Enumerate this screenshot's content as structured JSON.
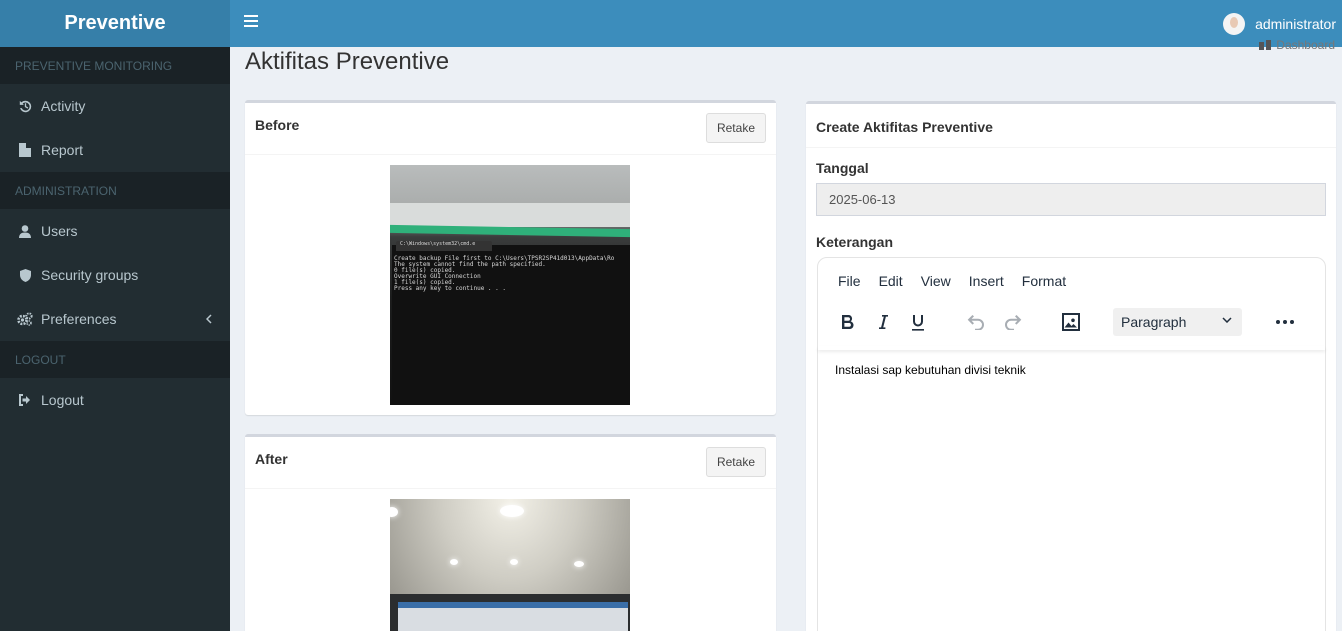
{
  "app": {
    "title": "Preventive"
  },
  "sidebar": {
    "sections": [
      {
        "header": "PREVENTIVE MONITORING",
        "items": [
          {
            "label": "Activity",
            "icon": "history-icon"
          },
          {
            "label": "Report",
            "icon": "file-icon"
          }
        ]
      },
      {
        "header": "ADMINISTRATION",
        "items": [
          {
            "label": "Users",
            "icon": "user-icon"
          },
          {
            "label": "Security groups",
            "icon": "shield-icon"
          },
          {
            "label": "Preferences",
            "icon": "gears-icon"
          }
        ]
      },
      {
        "header": "LOGOUT",
        "items": [
          {
            "label": "Logout",
            "icon": "sign-out-icon"
          }
        ]
      }
    ]
  },
  "topbar": {
    "username": "administrator"
  },
  "page": {
    "title": "Aktifitas Preventive",
    "breadcrumb": "Dashboard"
  },
  "before": {
    "title": "Before",
    "retake_label": "Retake",
    "terminal_tab": "C:\\Windows\\system32\\cmd.e",
    "terminal_lines": [
      "Create backup File first to C:\\Users\\TPSR2SP41d013\\AppData\\Ro",
      "The system cannot find the path specified.",
      "        0 file(s) copied.",
      "Overwrite GUI Connection",
      "        1 file(s) copied.",
      "Press any key to continue . . ."
    ]
  },
  "after": {
    "title": "After",
    "retake_label": "Retake"
  },
  "form": {
    "title": "Create Aktifitas Preventive",
    "tanggal_label": "Tanggal",
    "tanggal_value": "2025-06-13",
    "keterangan_label": "Keterangan",
    "editor": {
      "menu": [
        "File",
        "Edit",
        "View",
        "Insert",
        "Format"
      ],
      "block_format": "Paragraph",
      "content": "Instalasi sap kebutuhan divisi teknik"
    }
  },
  "colors": {
    "header_blue": "#3c8dbc",
    "logo_blue": "#367fa9",
    "sidebar_dark": "#222d32"
  }
}
